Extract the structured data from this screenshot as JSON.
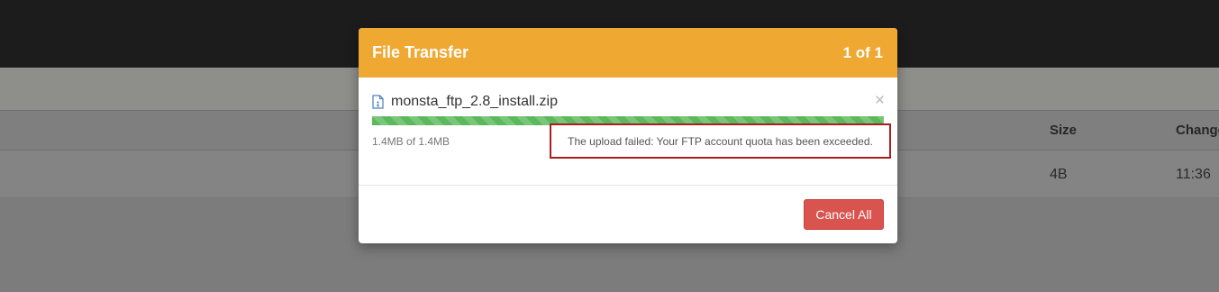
{
  "background": {
    "table": {
      "columns": [
        "Size",
        "Changed"
      ],
      "rows": [
        {
          "size": "4B",
          "changed": "11:36"
        }
      ]
    }
  },
  "dialog": {
    "title": "File Transfer",
    "counter": "1 of 1",
    "transfer": {
      "file_name": "monsta_ftp_2.8_install.zip",
      "progress_fraction": 1.0,
      "bytes_text": "1.4MB of 1.4MB",
      "error_message": "The upload failed: Your FTP account quota has been exceeded."
    },
    "close_symbol": "×",
    "cancel_all_label": "Cancel All"
  },
  "colors": {
    "header_accent": "#efa832",
    "progress": "#5cb85c",
    "cancel_button": "#d9534f",
    "error_outline": "#b11b1b"
  },
  "icons": {
    "file": "zip-file-icon",
    "close": "close-icon"
  }
}
